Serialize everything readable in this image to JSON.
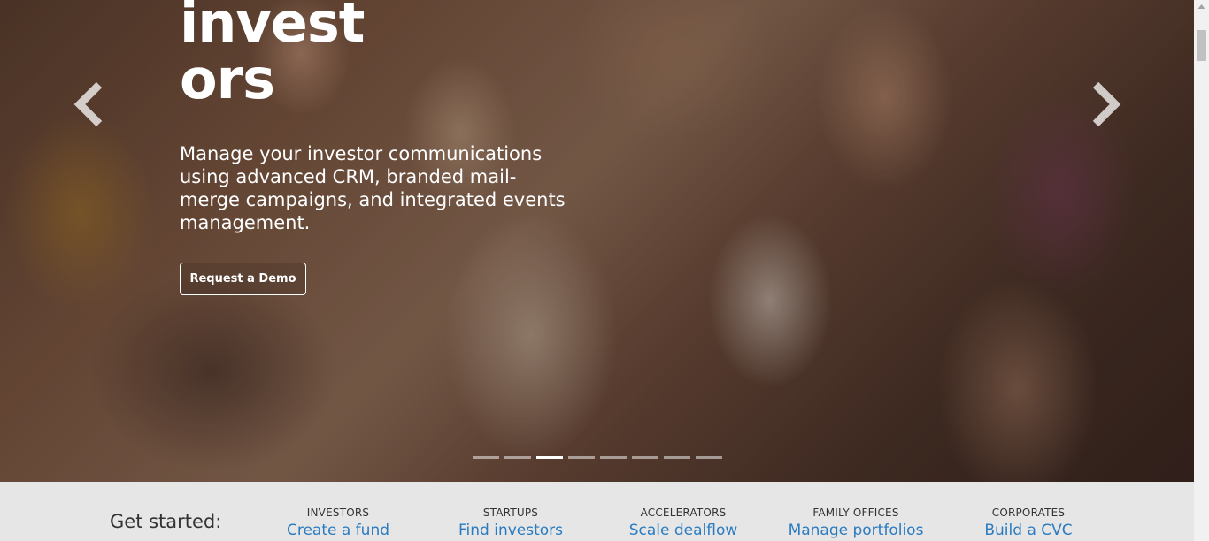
{
  "hero": {
    "title_line1": "invest",
    "title_line2": "ors",
    "description": "Manage your investor communications using advanced CRM, branded mail-merge campaigns, and integrated events management.",
    "cta_label": "Request a Demo",
    "indicators_count": 8,
    "active_indicator": 3
  },
  "get_started": {
    "label": "Get started:",
    "columns": [
      {
        "category": "INVESTORS",
        "link": "Create a fund"
      },
      {
        "category": "STARTUPS",
        "link": "Find investors"
      },
      {
        "category": "ACCELERATORS",
        "link": "Scale dealflow"
      },
      {
        "category": "FAMILY OFFICES",
        "link": "Manage portfolios"
      },
      {
        "category": "CORPORATES",
        "link": "Build a CVC"
      }
    ]
  },
  "colors": {
    "link": "#2a7bc0",
    "strip_background": "#e6e6e6",
    "text_dark": "#333333"
  },
  "icons": {
    "prev": "chevron-left-icon",
    "next": "chevron-right-icon",
    "scroll_up": "triangle-up-icon"
  }
}
